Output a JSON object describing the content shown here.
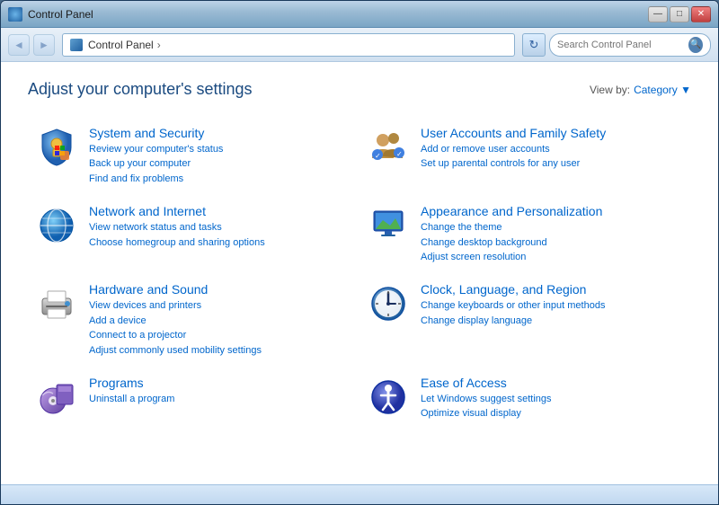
{
  "window": {
    "title": "Control Panel",
    "search_placeholder": "Search Control Panel"
  },
  "toolbar": {
    "back_label": "◄",
    "forward_label": "►",
    "breadcrumb": "Control Panel",
    "refresh_label": "↻",
    "view_by_label": "View by:",
    "view_by_value": "Category ▼"
  },
  "page": {
    "title": "Adjust your computer's settings",
    "view_by_label": "View by:",
    "view_by_value": "Category ▼"
  },
  "window_controls": {
    "minimize": "—",
    "maximize": "□",
    "close": "✕"
  },
  "categories": {
    "left": [
      {
        "id": "system-security",
        "title": "System and Security",
        "links": [
          "Review your computer's status",
          "Back up your computer",
          "Find and fix problems"
        ]
      },
      {
        "id": "network-internet",
        "title": "Network and Internet",
        "links": [
          "View network status and tasks",
          "Choose homegroup and sharing options"
        ]
      },
      {
        "id": "hardware-sound",
        "title": "Hardware and Sound",
        "links": [
          "View devices and printers",
          "Add a device",
          "Connect to a projector",
          "Adjust commonly used mobility settings"
        ]
      },
      {
        "id": "programs",
        "title": "Programs",
        "links": [
          "Uninstall a program"
        ]
      }
    ],
    "right": [
      {
        "id": "user-accounts",
        "title": "User Accounts and Family Safety",
        "links": [
          "Add or remove user accounts",
          "Set up parental controls for any user"
        ]
      },
      {
        "id": "appearance",
        "title": "Appearance and Personalization",
        "links": [
          "Change the theme",
          "Change desktop background",
          "Adjust screen resolution"
        ]
      },
      {
        "id": "clock",
        "title": "Clock, Language, and Region",
        "links": [
          "Change keyboards or other input methods",
          "Change display language"
        ]
      },
      {
        "id": "ease",
        "title": "Ease of Access",
        "links": [
          "Let Windows suggest settings",
          "Optimize visual display"
        ]
      }
    ]
  }
}
